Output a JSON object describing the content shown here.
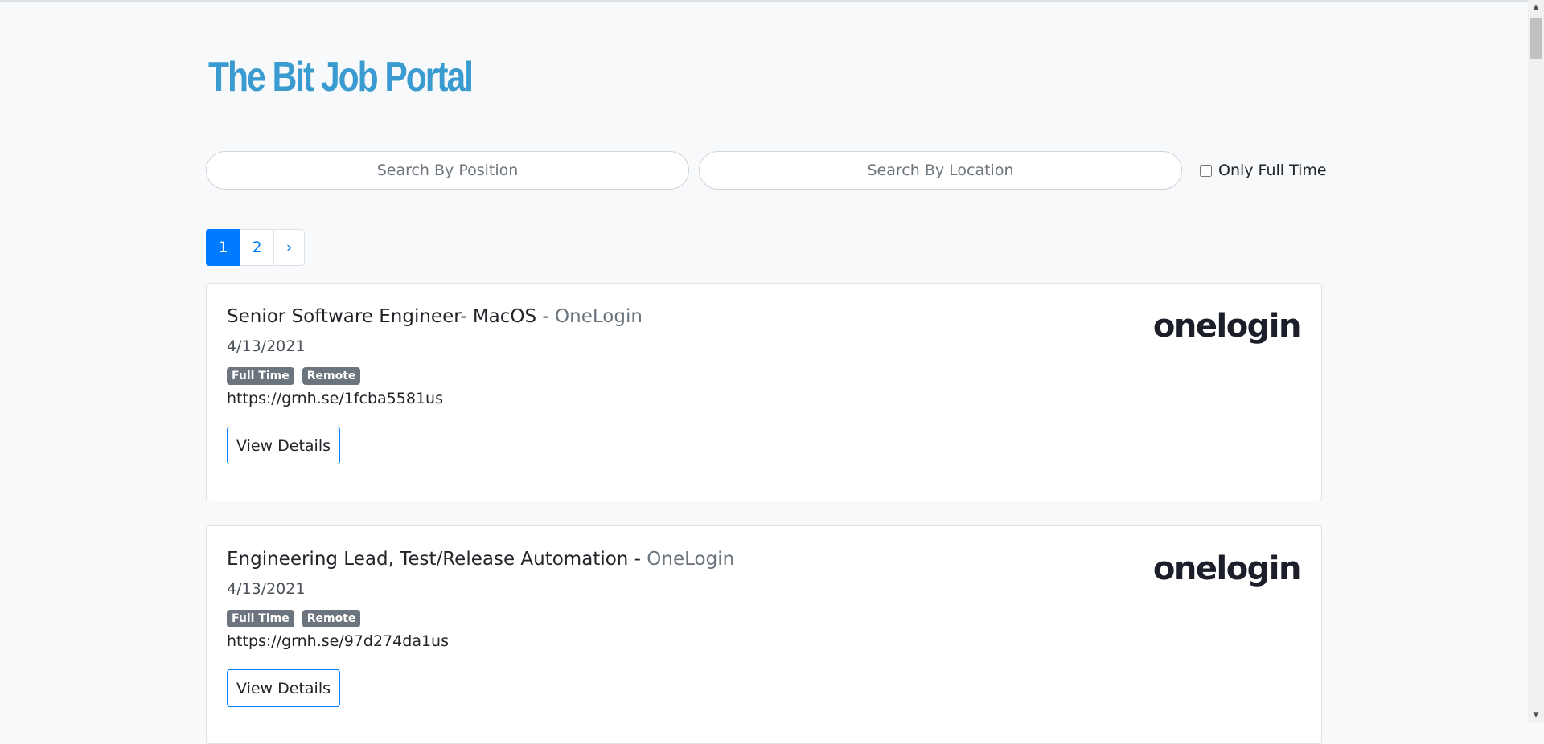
{
  "header": {
    "title": "The Bit Job Portal"
  },
  "search": {
    "position_placeholder": "Search By Position",
    "location_placeholder": "Search By Location",
    "fulltime_label": "Only Full Time",
    "fulltime_checked": false
  },
  "pagination": {
    "current": "1",
    "next_page": "2",
    "next_label": "›"
  },
  "jobs": [
    {
      "title": "Senior Software Engineer- MacOS",
      "separator": " - ",
      "company": "OneLogin",
      "date": "4/13/2021",
      "badges": [
        "Full Time",
        "Remote"
      ],
      "url": "https://grnh.se/1fcba5581us",
      "button": "View Details",
      "logo_text": "onelogin"
    },
    {
      "title": "Engineering Lead, Test/Release Automation",
      "separator": " - ",
      "company": "OneLogin",
      "date": "4/13/2021",
      "badges": [
        "Full Time",
        "Remote"
      ],
      "url": "https://grnh.se/97d274da1us",
      "button": "View Details",
      "logo_text": "onelogin"
    }
  ],
  "colors": {
    "accent": "#007bff",
    "title": "#3a9bd0",
    "badge": "#6c757d",
    "background": "#f8f9fa"
  },
  "icons": {
    "scroll_up": "scroll-up-arrow-icon",
    "scroll_down": "scroll-down-arrow-icon"
  }
}
